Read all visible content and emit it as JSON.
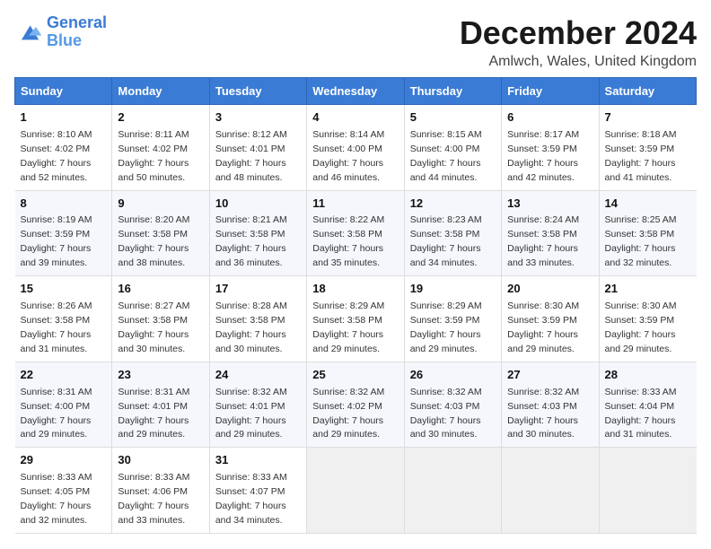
{
  "header": {
    "logo_line1": "General",
    "logo_line2": "Blue",
    "month_title": "December 2024",
    "location": "Amlwch, Wales, United Kingdom"
  },
  "weekdays": [
    "Sunday",
    "Monday",
    "Tuesday",
    "Wednesday",
    "Thursday",
    "Friday",
    "Saturday"
  ],
  "weeks": [
    [
      {
        "day": "1",
        "sunrise": "8:10 AM",
        "sunset": "4:02 PM",
        "daylight": "7 hours and 52 minutes."
      },
      {
        "day": "2",
        "sunrise": "8:11 AM",
        "sunset": "4:02 PM",
        "daylight": "7 hours and 50 minutes."
      },
      {
        "day": "3",
        "sunrise": "8:12 AM",
        "sunset": "4:01 PM",
        "daylight": "7 hours and 48 minutes."
      },
      {
        "day": "4",
        "sunrise": "8:14 AM",
        "sunset": "4:00 PM",
        "daylight": "7 hours and 46 minutes."
      },
      {
        "day": "5",
        "sunrise": "8:15 AM",
        "sunset": "4:00 PM",
        "daylight": "7 hours and 44 minutes."
      },
      {
        "day": "6",
        "sunrise": "8:17 AM",
        "sunset": "3:59 PM",
        "daylight": "7 hours and 42 minutes."
      },
      {
        "day": "7",
        "sunrise": "8:18 AM",
        "sunset": "3:59 PM",
        "daylight": "7 hours and 41 minutes."
      }
    ],
    [
      {
        "day": "8",
        "sunrise": "8:19 AM",
        "sunset": "3:59 PM",
        "daylight": "7 hours and 39 minutes."
      },
      {
        "day": "9",
        "sunrise": "8:20 AM",
        "sunset": "3:58 PM",
        "daylight": "7 hours and 38 minutes."
      },
      {
        "day": "10",
        "sunrise": "8:21 AM",
        "sunset": "3:58 PM",
        "daylight": "7 hours and 36 minutes."
      },
      {
        "day": "11",
        "sunrise": "8:22 AM",
        "sunset": "3:58 PM",
        "daylight": "7 hours and 35 minutes."
      },
      {
        "day": "12",
        "sunrise": "8:23 AM",
        "sunset": "3:58 PM",
        "daylight": "7 hours and 34 minutes."
      },
      {
        "day": "13",
        "sunrise": "8:24 AM",
        "sunset": "3:58 PM",
        "daylight": "7 hours and 33 minutes."
      },
      {
        "day": "14",
        "sunrise": "8:25 AM",
        "sunset": "3:58 PM",
        "daylight": "7 hours and 32 minutes."
      }
    ],
    [
      {
        "day": "15",
        "sunrise": "8:26 AM",
        "sunset": "3:58 PM",
        "daylight": "7 hours and 31 minutes."
      },
      {
        "day": "16",
        "sunrise": "8:27 AM",
        "sunset": "3:58 PM",
        "daylight": "7 hours and 30 minutes."
      },
      {
        "day": "17",
        "sunrise": "8:28 AM",
        "sunset": "3:58 PM",
        "daylight": "7 hours and 30 minutes."
      },
      {
        "day": "18",
        "sunrise": "8:29 AM",
        "sunset": "3:58 PM",
        "daylight": "7 hours and 29 minutes."
      },
      {
        "day": "19",
        "sunrise": "8:29 AM",
        "sunset": "3:59 PM",
        "daylight": "7 hours and 29 minutes."
      },
      {
        "day": "20",
        "sunrise": "8:30 AM",
        "sunset": "3:59 PM",
        "daylight": "7 hours and 29 minutes."
      },
      {
        "day": "21",
        "sunrise": "8:30 AM",
        "sunset": "3:59 PM",
        "daylight": "7 hours and 29 minutes."
      }
    ],
    [
      {
        "day": "22",
        "sunrise": "8:31 AM",
        "sunset": "4:00 PM",
        "daylight": "7 hours and 29 minutes."
      },
      {
        "day": "23",
        "sunrise": "8:31 AM",
        "sunset": "4:01 PM",
        "daylight": "7 hours and 29 minutes."
      },
      {
        "day": "24",
        "sunrise": "8:32 AM",
        "sunset": "4:01 PM",
        "daylight": "7 hours and 29 minutes."
      },
      {
        "day": "25",
        "sunrise": "8:32 AM",
        "sunset": "4:02 PM",
        "daylight": "7 hours and 29 minutes."
      },
      {
        "day": "26",
        "sunrise": "8:32 AM",
        "sunset": "4:03 PM",
        "daylight": "7 hours and 30 minutes."
      },
      {
        "day": "27",
        "sunrise": "8:32 AM",
        "sunset": "4:03 PM",
        "daylight": "7 hours and 30 minutes."
      },
      {
        "day": "28",
        "sunrise": "8:33 AM",
        "sunset": "4:04 PM",
        "daylight": "7 hours and 31 minutes."
      }
    ],
    [
      {
        "day": "29",
        "sunrise": "8:33 AM",
        "sunset": "4:05 PM",
        "daylight": "7 hours and 32 minutes."
      },
      {
        "day": "30",
        "sunrise": "8:33 AM",
        "sunset": "4:06 PM",
        "daylight": "7 hours and 33 minutes."
      },
      {
        "day": "31",
        "sunrise": "8:33 AM",
        "sunset": "4:07 PM",
        "daylight": "7 hours and 34 minutes."
      },
      null,
      null,
      null,
      null
    ]
  ]
}
